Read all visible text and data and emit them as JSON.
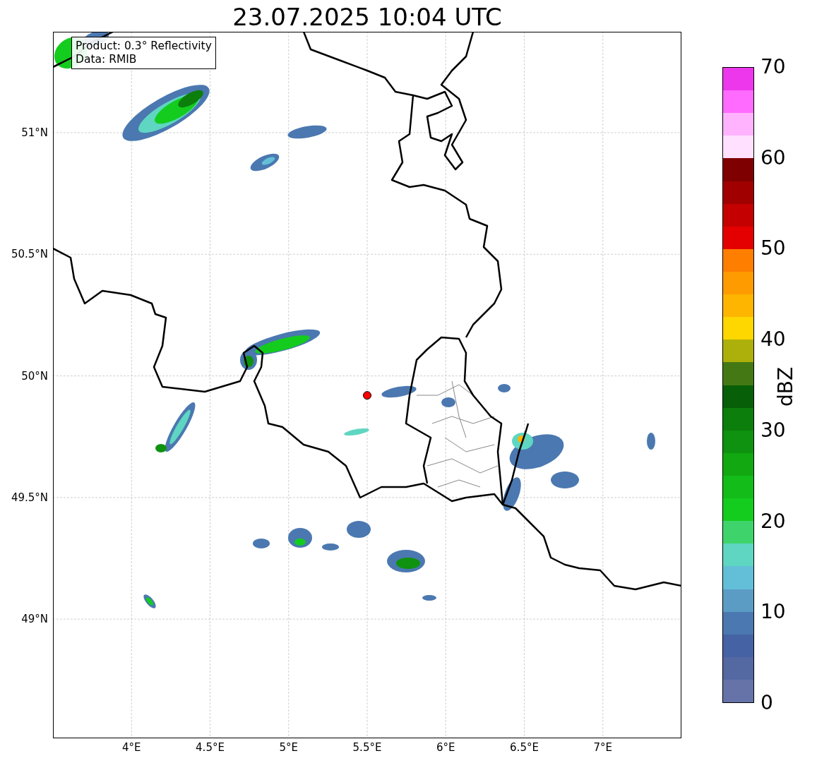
{
  "title": "23.07.2025 10:04 UTC",
  "legend": {
    "product": "Product: 0.3° Reflectivity",
    "data": "Data: RMIB"
  },
  "map": {
    "xticks": [
      "4°E",
      "4.5°E",
      "5°E",
      "5.5°E",
      "6°E",
      "6.5°E",
      "7°E"
    ],
    "yticks": [
      "51°N",
      "50.5°N",
      "50°N",
      "49.5°N",
      "49°N"
    ]
  },
  "colorbar": {
    "label": "dBZ",
    "ticks": [
      "70",
      "60",
      "50",
      "40",
      "30",
      "20",
      "10",
      "0"
    ],
    "segments": [
      {
        "color": "#ec37ec"
      },
      {
        "color": "#ff6bff"
      },
      {
        "color": "#ffb3ff"
      },
      {
        "color": "#ffe0ff"
      },
      {
        "color": "#7e0000"
      },
      {
        "color": "#a10000"
      },
      {
        "color": "#c40000"
      },
      {
        "color": "#e40000"
      },
      {
        "color": "#fe7e00"
      },
      {
        "color": "#fd9b00"
      },
      {
        "color": "#fdb500"
      },
      {
        "color": "#fed600"
      },
      {
        "color": "#adb00a"
      },
      {
        "color": "#447815"
      },
      {
        "color": "#075f07"
      },
      {
        "color": "#0c7e0c"
      },
      {
        "color": "#0f920f"
      },
      {
        "color": "#11a811"
      },
      {
        "color": "#13bc19"
      },
      {
        "color": "#14cc1e"
      },
      {
        "color": "#3fd46b"
      },
      {
        "color": "#5fd6c2"
      },
      {
        "color": "#63bfd8"
      },
      {
        "color": "#5b9cc5"
      },
      {
        "color": "#4b78b0"
      },
      {
        "color": "#4563a4"
      },
      {
        "color": "#5468a2"
      },
      {
        "color": "#6673a8"
      }
    ]
  }
}
